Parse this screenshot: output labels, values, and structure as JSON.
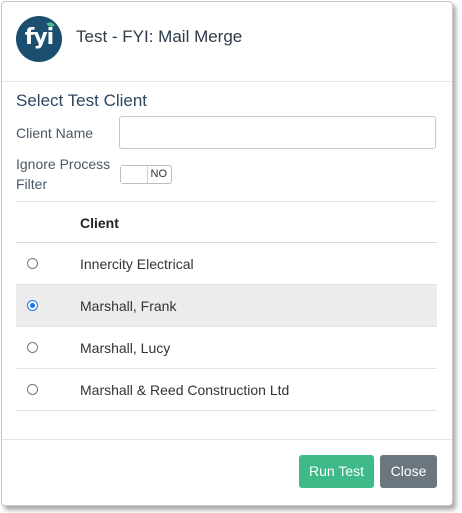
{
  "header": {
    "logo_text": "fyi",
    "title": "Test - FYI: Mail Merge"
  },
  "form": {
    "section_title": "Select Test Client",
    "client_name_label": "Client Name",
    "client_name_value": "",
    "client_name_placeholder": "",
    "ignore_filter_label": "Ignore Process Filter",
    "ignore_filter_value": "NO"
  },
  "table": {
    "column_header": "Client",
    "rows": [
      {
        "name": "Innercity Electrical",
        "selected": false
      },
      {
        "name": "Marshall, Frank",
        "selected": true
      },
      {
        "name": "Marshall, Lucy",
        "selected": false
      },
      {
        "name": "Marshall & Reed Construction Ltd",
        "selected": false
      }
    ]
  },
  "footer": {
    "run_test_label": "Run Test",
    "close_label": "Close"
  },
  "colors": {
    "logo_bg": "#1c4e70",
    "primary_button": "#3dba87",
    "secondary_button": "#6c767f",
    "radio_checked": "#1a73e8"
  }
}
